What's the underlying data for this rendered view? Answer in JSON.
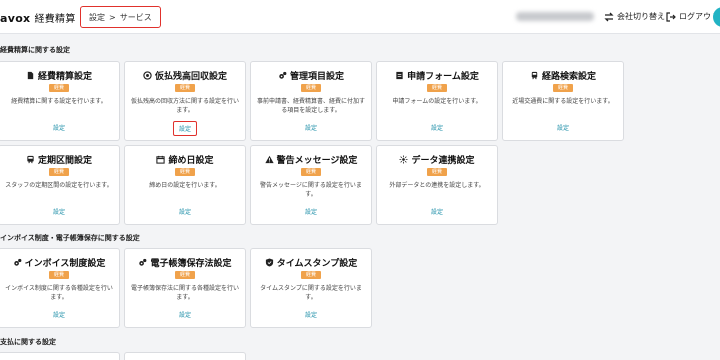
{
  "app": {
    "logo_text": "avox",
    "logo_subtitle": "経費精算"
  },
  "breadcrumb": {
    "item1": "設定",
    "separator": ">",
    "item2": "サービス"
  },
  "header": {
    "switch_company_label": "会社切り替え",
    "logout_label": "ログアウト"
  },
  "sections": [
    {
      "title": "経費精算に関する設定",
      "cards": [
        {
          "icon": "document-icon",
          "title": "経費精算設定",
          "badge": "経費",
          "desc": "経費精算に関する設定を行います。",
          "link": "設定"
        },
        {
          "icon": "coin-icon",
          "title": "仮払残高回収設定",
          "badge": "経費",
          "desc": "仮払残高の回収方法に関する設定を行います。",
          "link": "設定"
        },
        {
          "icon": "gears-icon",
          "title": "管理項目設定",
          "badge": "経費",
          "desc": "事前申請書、経費精算書、経費に付加する項目を設定します。",
          "link": "設定"
        },
        {
          "icon": "form-icon",
          "title": "申請フォーム設定",
          "badge": "経費",
          "desc": "申請フォームの設定を行います。",
          "link": "設定"
        },
        {
          "icon": "train-icon",
          "title": "経路検索設定",
          "badge": "経費",
          "desc": "近場交通費に関する設定を行います。",
          "link": "設定"
        },
        {
          "icon": "pass-icon",
          "title": "定期区間設定",
          "badge": "経費",
          "desc": "スタッフの定期区間の設定を行います。",
          "link": "設定"
        },
        {
          "icon": "calendar-icon",
          "title": "締め日設定",
          "badge": "経費",
          "desc": "締め日の設定を行います。",
          "link": "設定"
        },
        {
          "icon": "warning-icon",
          "title": "警告メッセージ設定",
          "badge": "経費",
          "desc": "警告メッセージに関する設定を行います。",
          "link": "設定"
        },
        {
          "icon": "sync-icon",
          "title": "データ連携設定",
          "badge": "経費",
          "desc": "外部データとの連携を設定します。",
          "link": "設定"
        }
      ]
    },
    {
      "title": "インボイス制度・電子帳簿保存に関する設定",
      "cards": [
        {
          "icon": "gears-icon",
          "title": "インボイス制度設定",
          "badge": "経費",
          "desc": "インボイス制度に関する各種設定を行います。",
          "link": "設定"
        },
        {
          "icon": "gears-icon",
          "title": "電子帳簿保存法設定",
          "badge": "経費",
          "desc": "電子帳簿保存法に関する各種設定を行います。",
          "link": "設定"
        },
        {
          "icon": "shield-icon",
          "title": "タイムスタンプ設定",
          "badge": "経費",
          "desc": "タイムスタンプに関する設定を行います。",
          "link": "設定"
        }
      ]
    },
    {
      "title": "支払に関する設定"
    }
  ]
}
